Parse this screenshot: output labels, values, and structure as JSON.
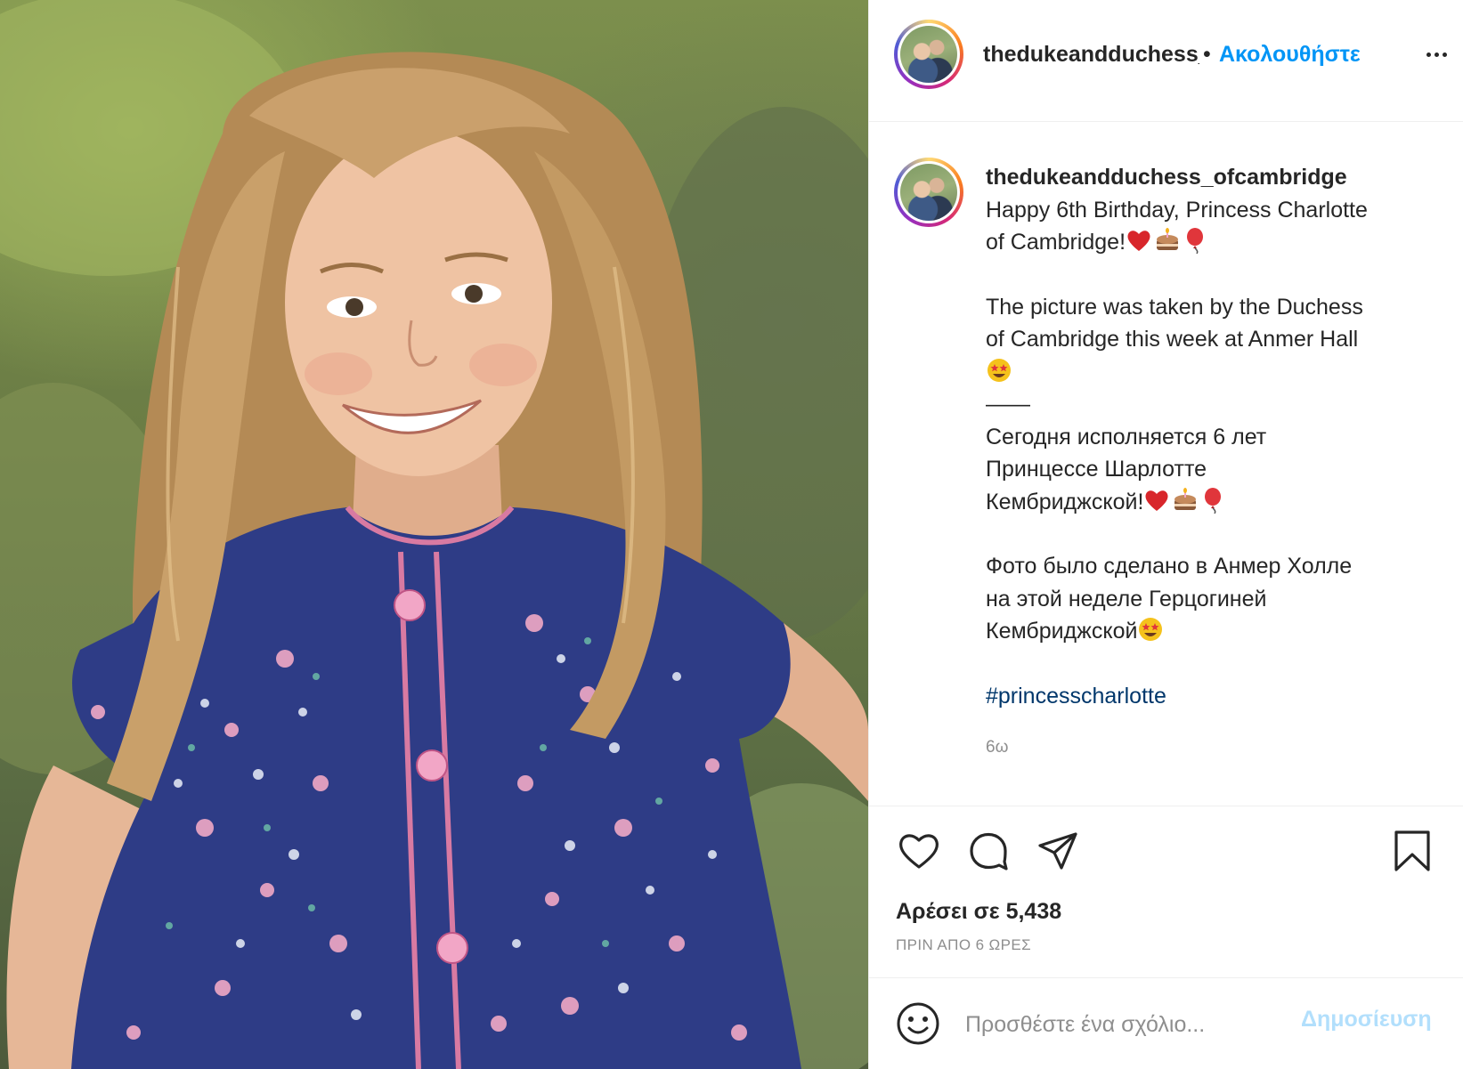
{
  "post": {
    "photo_alt": "Photo of smiling girl with long blond hair wearing a blue floral dress"
  },
  "header": {
    "username": "thedukeandduchess_ofcambridge",
    "separator": "•",
    "follow_label": "Ακολουθήστε",
    "more_icon": "more-horizontal-icon"
  },
  "caption": {
    "username": "thedukeandduchess_ofcambridge",
    "lines": {
      "l1": "Happy 6th Birthday, Princess Charlotte",
      "l2": "of Cambridge!",
      "l3": "The picture was taken by the Duchess",
      "l4": "of Cambridge this week at Anmer Hall",
      "l5": "——",
      "l6": "Сегодня исполняется 6 лет",
      "l7": "Принцессе Шарлотте",
      "l8": "Кембриджской!",
      "l9": "Фото было сделано в Анмер Холле",
      "l10": "на этой неделе Герцогиней",
      "l11": "Кембриджской"
    },
    "hashtag": "#princesscharlotte",
    "time": "6ω",
    "emojis": [
      "red-heart",
      "birthday-cake",
      "balloon",
      "star-struck"
    ]
  },
  "actions": {
    "like_icon": "heart-icon",
    "comment_icon": "comment-icon",
    "share_icon": "paper-plane-icon",
    "save_icon": "bookmark-icon",
    "likes_text": "Αρέσει σε 5,438",
    "posted_ago": "ΠΡΙΝ ΑΠΟ 6 ΩΡΕΣ"
  },
  "comment_box": {
    "placeholder": "Προσθέστε ένα σχόλιο...",
    "post_label": "Δημοσίευση",
    "emoji_icon": "smiley-icon"
  },
  "colors": {
    "link_blue": "#0095f6",
    "hashtag": "#00376b",
    "muted": "#8e8e8e",
    "post_disabled": "#b2dffc",
    "text": "#262626"
  }
}
